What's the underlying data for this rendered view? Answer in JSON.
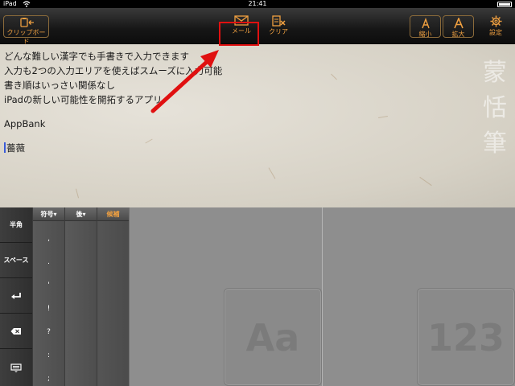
{
  "status": {
    "carrier": "iPad",
    "time": "21:41"
  },
  "toolbar": {
    "clipboard_label": "クリップボード",
    "mail_label": "メール",
    "clear_label": "クリア",
    "smaller_label": "縮小",
    "bigger_label": "拡大",
    "settings_label": "設定"
  },
  "document": {
    "lines": [
      "どんな難しい漢字でも手書きで入力できます",
      "入力も2つの入力エリアを使えばスムーズに入力可能",
      "書き順はいっさい関係なし",
      "iPadの新しい可能性を開拓するアプリ"
    ],
    "line5": "AppBank",
    "line6": "薔薇"
  },
  "watermark": [
    "蒙",
    "恬",
    "筆"
  ],
  "keys": {
    "hankaku": "半角",
    "space": "スペース"
  },
  "columns": {
    "symbols_header": "符号▾",
    "after_header": "後▾",
    "candidates_header": "候補",
    "symbols": [
      ",",
      ".",
      "'",
      "!",
      "?",
      ":",
      ";"
    ]
  },
  "pads": {
    "pad1": "Aa",
    "pad2": "123"
  },
  "colors": {
    "accent": "#f0a040",
    "highlight": "#e01010",
    "cursor": "#3a5bd8"
  }
}
